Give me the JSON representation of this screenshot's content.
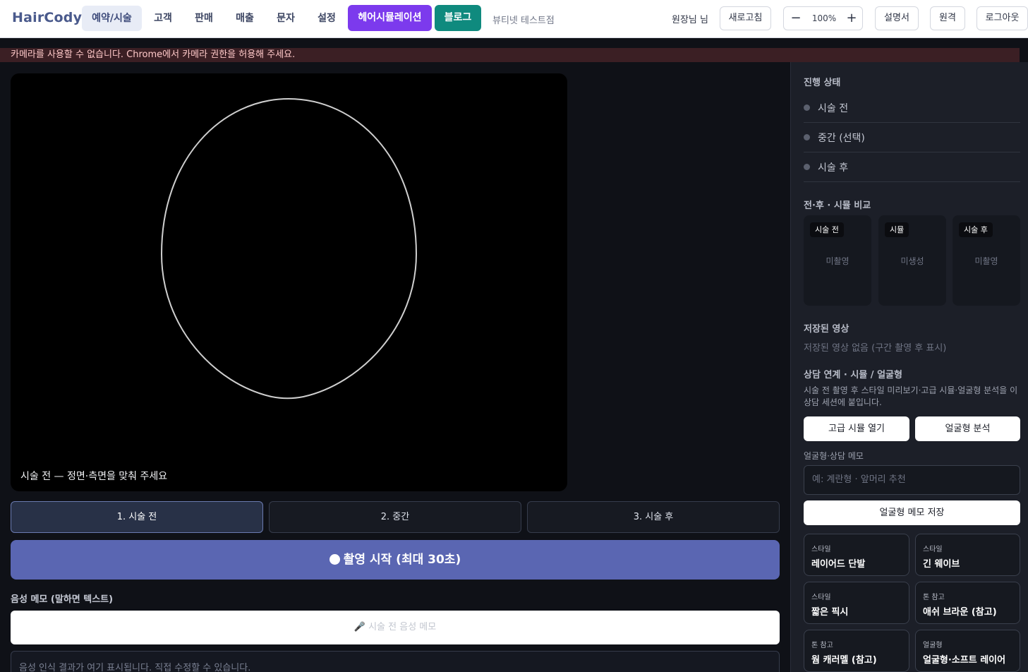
{
  "header": {
    "brand": "HairCody",
    "tabs": [
      {
        "label": "예약/시술"
      },
      {
        "label": "고객"
      },
      {
        "label": "판매"
      },
      {
        "label": "매출"
      },
      {
        "label": "문자"
      },
      {
        "label": "설정"
      }
    ],
    "simulation_label": "헤어시뮬레이션",
    "blog_label": "블로그",
    "shop_name": "뷰티넷 테스트점",
    "owner": "원장님 님",
    "refresh_label": "새로고침",
    "zoom": {
      "minus": "−",
      "value": "100%",
      "plus": "+"
    },
    "manual_label": "설명서",
    "remote_label": "원격",
    "logout_label": "로그아웃"
  },
  "banner": {
    "message": "카메라를 사용할 수 없습니다. Chrome에서 카메라 권한을 허용해 주세요."
  },
  "camera": {
    "caption": "시술 전 — 정면·측면을 맞춰 주세요"
  },
  "phases": [
    {
      "label": "1. 시술 전",
      "active": true
    },
    {
      "label": "2. 중간",
      "active": false
    },
    {
      "label": "3. 시술 후",
      "active": false
    }
  ],
  "record": {
    "label": "촬영 시작 (최대 30초)"
  },
  "voice": {
    "title": "음성 메모 (말하면 텍스트)",
    "button_label": "🎤 시술 전 음성 메모",
    "placeholder": "음성 인식 결과가 여기 표시됩니다. 직접 수정할 수 있습니다."
  },
  "panel": {
    "progress_title": "진행 상태",
    "progress_items": [
      {
        "label": "시술 전"
      },
      {
        "label": "중간 (선택)"
      },
      {
        "label": "시술 후"
      }
    ],
    "compare_title": "전·후 · 시뮬 비교",
    "compare_cards": [
      {
        "tag": "시술 전",
        "empty": "미촬영"
      },
      {
        "tag": "시뮬",
        "empty": "미생성"
      },
      {
        "tag": "시술 후",
        "empty": "미촬영"
      }
    ],
    "saved_title": "저장된 영상",
    "saved_empty": "저장된 영상 없음 (구간 촬영 후 표시)",
    "consult_title": "상담 연계 · 시뮬 / 얼굴형",
    "consult_desc": "시술 전 촬영 후 스타일 미리보기·고급 시뮬·얼굴형 분석을 이 상담 세션에 붙입니다.",
    "advanced_sim_label": "고급 시뮬 열기",
    "face_analysis_label": "얼굴형 분석",
    "memo_label": "얼굴형·상담 메모",
    "memo_placeholder": "예: 계란형 · 앞머리 추천",
    "memo_save_label": "얼굴형 메모 저장",
    "style_cards": [
      {
        "kind": "스타일",
        "name": "레이어드 단발"
      },
      {
        "kind": "스타일",
        "name": "긴 웨이브"
      },
      {
        "kind": "스타일",
        "name": "짧은 픽시"
      },
      {
        "kind": "톤 참고",
        "name": "애쉬 브라운 (참고)"
      },
      {
        "kind": "톤 참고",
        "name": "웜 캐러멜 (참고)"
      },
      {
        "kind": "얼굴형",
        "name": "얼굴형·소프트 레이어"
      }
    ]
  }
}
